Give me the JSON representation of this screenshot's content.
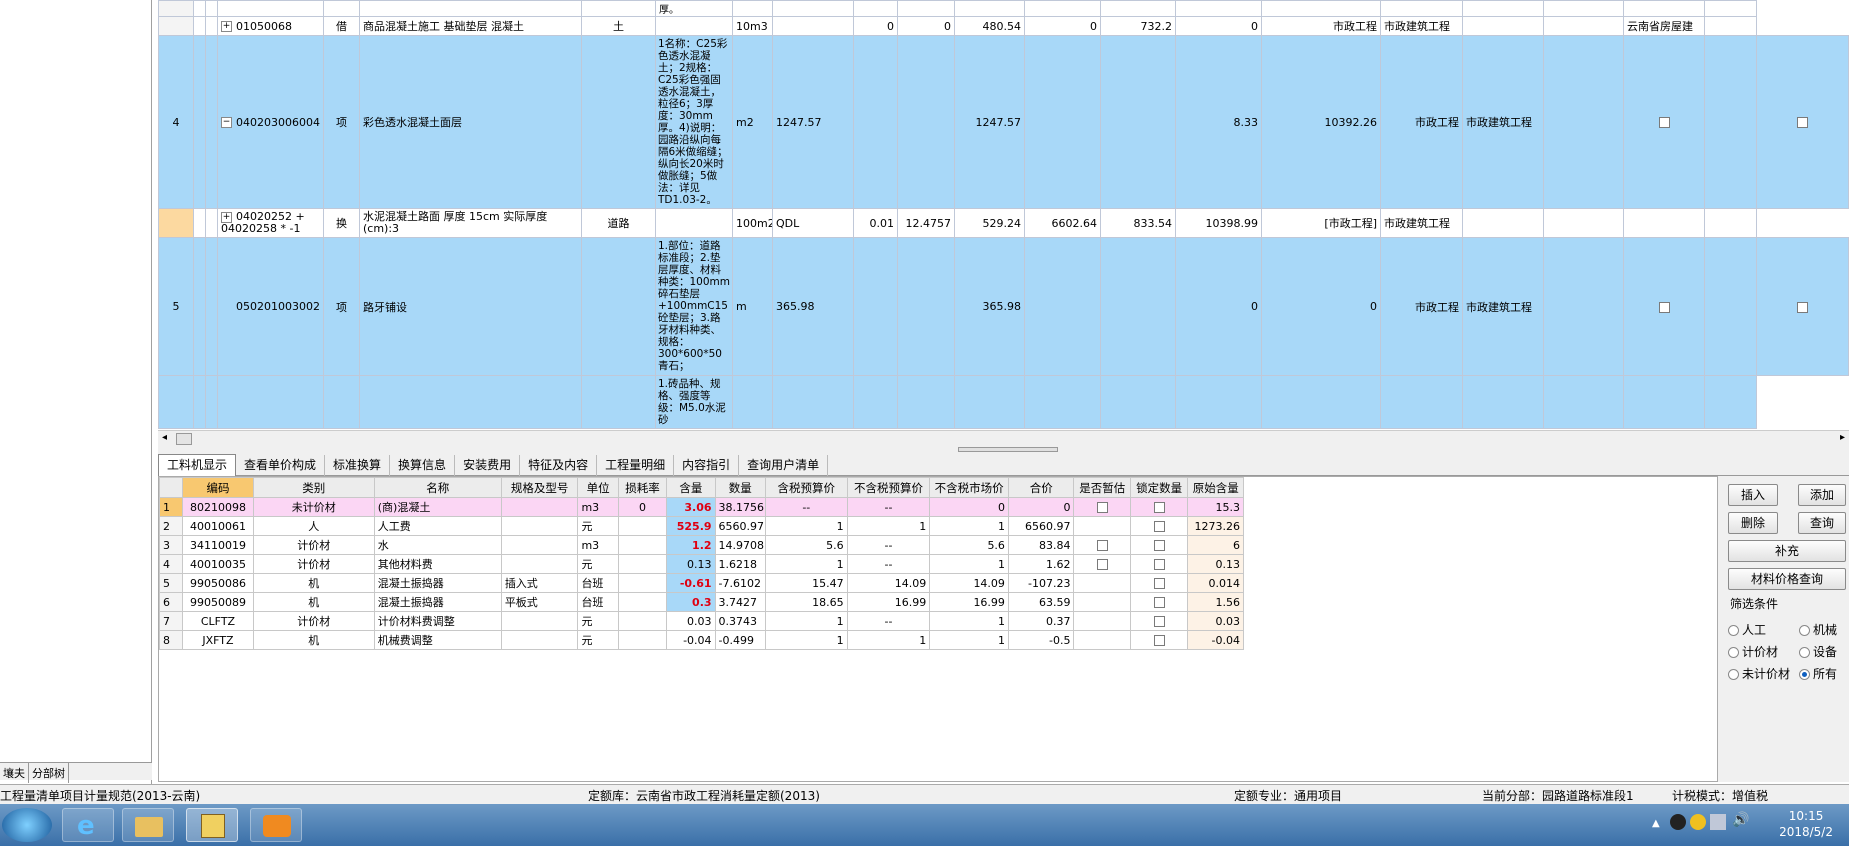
{
  "upper_rows": [
    {
      "rownum": "",
      "code": "01050068",
      "type": "借",
      "name": "商品混凝土施工 基础垫层 混凝土",
      "specialty_col": "土",
      "feature": "",
      "unit": "10m3",
      "expr": "",
      "qty_ratio": "0",
      "qty": "0",
      "unit_price": "480.54",
      "total": "0",
      "col_a": "732.2",
      "col_b": "0",
      "category": "市政工程",
      "subcategory": "市政建筑工程",
      "extra": "云南省房屋建"
    },
    {
      "rownum": "4",
      "code": "040203006004",
      "type": "项",
      "name": "彩色透水混凝土面层",
      "specialty_col": "",
      "feature": "1名称：C25彩色透水混凝土；2规格：C25彩色强固透水混凝土，粒径6；3厚度：30mm厚。4)说明：园路沿纵向每隔6米做缩缝；纵向长20米时做胀缝；5做法：详见TD1.03-2。",
      "unit": "m2",
      "expr": "1247.57",
      "qty_ratio": "",
      "qty": "1247.57",
      "unit_price": "",
      "total": "",
      "col_a": "8.33",
      "col_b": "10392.26",
      "category": "市政工程",
      "subcategory": "市政建筑工程",
      "extra": ""
    },
    {
      "rownum": "",
      "code": "04020252 + 04020258 * -1",
      "type": "换",
      "name": "水泥混凝土路面 厚度 15cm 实际厚度(cm):3",
      "specialty_col": "道路",
      "feature": "",
      "unit": "100m2",
      "expr": "QDL",
      "qty_ratio": "0.01",
      "qty": "12.4757",
      "unit_price": "529.24",
      "total": "6602.64",
      "col_a": "833.54",
      "col_b": "10398.99",
      "category": "[市政工程]",
      "subcategory": "市政建筑工程",
      "extra": ""
    },
    {
      "rownum": "5",
      "code": "050201003002",
      "type": "项",
      "name": "路牙铺设",
      "specialty_col": "",
      "feature": "1.部位：道路标准段；2.垫层厚度、材料种类：100mm碎石垫层+100mmC15砼垫层；3.路牙材料种类、规格：300*600*50青石；",
      "unit": "m",
      "expr": "365.98",
      "qty_ratio": "",
      "qty": "365.98",
      "unit_price": "",
      "total": "",
      "col_a": "0",
      "col_b": "0",
      "category": "市政工程",
      "subcategory": "市政建筑工程",
      "extra": ""
    },
    {
      "rownum": "",
      "code": "",
      "type": "",
      "name": "",
      "specialty_col": "",
      "feature": "1.砖品种、规格、强度等级：M5.0水泥砂",
      "unit": "",
      "expr": "",
      "qty_ratio": "",
      "qty": "",
      "unit_price": "",
      "total": "",
      "col_a": "",
      "col_b": "",
      "category": "",
      "subcategory": "",
      "extra": ""
    }
  ],
  "upper_top_fragment": "厚。",
  "left_tabs": [
    "壤夫",
    "分部树"
  ],
  "tabs": [
    "工料机显示",
    "查看单价构成",
    "标准换算",
    "换算信息",
    "安装费用",
    "特征及内容",
    "工程量明细",
    "内容指引",
    "查询用户清单"
  ],
  "lower_headers": [
    "",
    "编码",
    "类别",
    "名称",
    "规格及型号",
    "单位",
    "损耗率",
    "含量",
    "数量",
    "含税预算价",
    "不含税预算价",
    "不含税市场价",
    "合价",
    "是否暂估",
    "锁定数量",
    "原始含量"
  ],
  "lower_rows": [
    {
      "n": "1",
      "code": "80210098",
      "cat": "未计价材",
      "name": "(商)混凝土",
      "spec": "",
      "unit": "m3",
      "loss": "0",
      "content": "3.06",
      "qty": "38.1756",
      "tax_budget": "--",
      "notax_budget": "--",
      "notax_market": "0",
      "total": "0",
      "est": true,
      "lock": true,
      "orig": "15.3"
    },
    {
      "n": "2",
      "code": "40010061",
      "cat": "人",
      "name": "人工费",
      "spec": "",
      "unit": "元",
      "loss": "",
      "content": "525.9",
      "qty": "6560.97",
      "tax_budget": "1",
      "notax_budget": "1",
      "notax_market": "1",
      "total": "6560.97",
      "est": false,
      "lock": true,
      "orig": "1273.26"
    },
    {
      "n": "3",
      "code": "34110019",
      "cat": "计价材",
      "name": "水",
      "spec": "",
      "unit": "m3",
      "loss": "",
      "content": "1.2",
      "qty": "14.9708",
      "tax_budget": "5.6",
      "notax_budget": "--",
      "notax_market": "5.6",
      "total": "83.84",
      "est": true,
      "lock": true,
      "orig": "6"
    },
    {
      "n": "4",
      "code": "40010035",
      "cat": "计价材",
      "name": "其他材料费",
      "spec": "",
      "unit": "元",
      "loss": "",
      "content": "0.13",
      "qty": "1.6218",
      "tax_budget": "1",
      "notax_budget": "--",
      "notax_market": "1",
      "total": "1.62",
      "est": true,
      "lock": true,
      "orig": "0.13"
    },
    {
      "n": "5",
      "code": "99050086",
      "cat": "机",
      "name": "混凝土振捣器",
      "spec": "插入式",
      "unit": "台班",
      "loss": "",
      "content": "-0.61",
      "qty": "-7.6102",
      "tax_budget": "15.47",
      "notax_budget": "14.09",
      "notax_market": "14.09",
      "total": "-107.23",
      "est": false,
      "lock": true,
      "orig": "0.014"
    },
    {
      "n": "6",
      "code": "99050089",
      "cat": "机",
      "name": "混凝土振捣器",
      "spec": "平板式",
      "unit": "台班",
      "loss": "",
      "content": "0.3",
      "qty": "3.7427",
      "tax_budget": "18.65",
      "notax_budget": "16.99",
      "notax_market": "16.99",
      "total": "63.59",
      "est": false,
      "lock": true,
      "orig": "1.56"
    },
    {
      "n": "7",
      "code": "CLFTZ",
      "cat": "计价材",
      "name": "计价材料费调整",
      "spec": "",
      "unit": "元",
      "loss": "",
      "content": "0.03",
      "qty": "0.3743",
      "tax_budget": "1",
      "notax_budget": "--",
      "notax_market": "1",
      "total": "0.37",
      "est": false,
      "lock": true,
      "orig": "0.03"
    },
    {
      "n": "8",
      "code": "JXFTZ",
      "cat": "机",
      "name": "机械费调整",
      "spec": "",
      "unit": "元",
      "loss": "",
      "content": "-0.04",
      "qty": "-0.499",
      "tax_budget": "1",
      "notax_budget": "1",
      "notax_market": "1",
      "total": "-0.5",
      "est": false,
      "lock": true,
      "orig": "-0.04"
    }
  ],
  "right_panel": {
    "insert": "插入",
    "add": "添加",
    "delete": "删除",
    "query": "查询",
    "supplement": "补充",
    "price_query": "材料价格查询",
    "filter_title": "筛选条件",
    "radios": [
      "人工",
      "机械",
      "计价材",
      "设备",
      "未计价材",
      "所有"
    ],
    "selected_radio": "所有"
  },
  "status": {
    "spec": "工程量清单项目计量规范(2013-云南)",
    "quota_lib": "定额库：云南省市政工程消耗量定额(2013)",
    "quota_major": "定额专业：通用项目",
    "current_section": "当前分部：园路道路标准段1",
    "tax_mode": "计税模式：增值税"
  },
  "clock": {
    "time": "10:15",
    "date": "2018/5/2"
  },
  "colors": {
    "selected_row": "#a8d8f8",
    "header_highlight": "#f8c870",
    "pink_row": "#fbd6f4",
    "red_value": "#e00010"
  }
}
